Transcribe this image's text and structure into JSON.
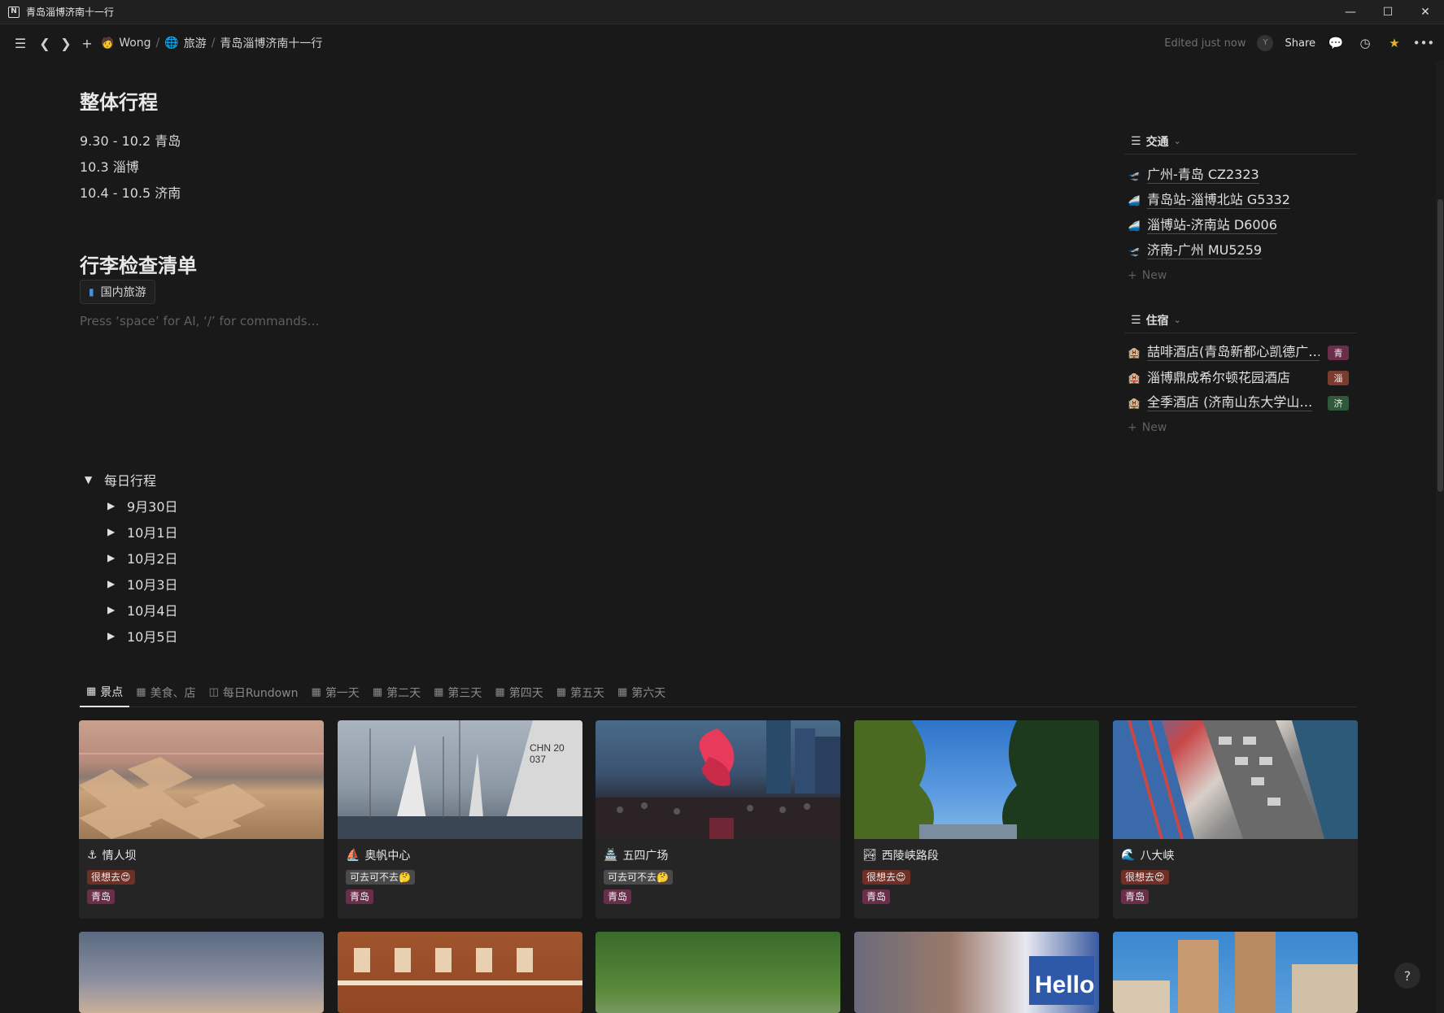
{
  "window": {
    "title": "青岛淄博济南十一行"
  },
  "breadcrumb": {
    "user": "Wong",
    "section": "旅游",
    "page": "青岛淄博济南十一行"
  },
  "topbar": {
    "edited": "Edited just now",
    "avatar_initial": "Y",
    "share": "Share"
  },
  "itinerary": {
    "title": "整体行程",
    "lines": [
      "9.30 - 10.2 青岛",
      "10.3 淄博",
      "10.4 - 10.5 济南"
    ]
  },
  "checklist": {
    "title": "行李检查清单",
    "chip": "国内旅游",
    "placeholder": "Press ‘space’ for AI, ‘/’ for commands…"
  },
  "daily": {
    "title": "每日行程",
    "days": [
      "9月30日",
      "10月1日",
      "10月2日",
      "10月3日",
      "10月4日",
      "10月5日"
    ]
  },
  "transport": {
    "title": "交通",
    "items": [
      {
        "label": "广州-青岛 CZ2323",
        "icon": "plane-icon"
      },
      {
        "label": "青岛站-淄博北站 G5332",
        "icon": "train-icon"
      },
      {
        "label": "淄博站-济南站 D6006",
        "icon": "train-icon"
      },
      {
        "label": "济南-广州 MU5259",
        "icon": "plane-icon"
      }
    ],
    "new": "New"
  },
  "lodging": {
    "title": "住宿",
    "items": [
      {
        "label": "喆啡酒店(青岛新都心凯德广…",
        "tag": "青",
        "color": "#6b2e4a"
      },
      {
        "label": "淄博鼎成希尔顿花园酒店",
        "tag": "淄",
        "color": "#7a3c2e"
      },
      {
        "label": "全季酒店 (济南山东大学山…",
        "tag": "济",
        "color": "#2f5a3a"
      }
    ],
    "new": "New"
  },
  "tabs": [
    "景点",
    "美食、店",
    "每日Rundown",
    "第一天",
    "第二天",
    "第三天",
    "第四天",
    "第五天",
    "第六天"
  ],
  "cards": [
    {
      "icon": "⚓",
      "title": "情人坝",
      "status": "很想去😍",
      "status_color": "#6e2f26",
      "city": "青岛",
      "city_color": "#6b2e4a"
    },
    {
      "icon": "⛵",
      "title": "奥帆中心",
      "status": "可去可不去🤔",
      "status_color": "#4a4a4a",
      "city": "青岛",
      "city_color": "#6b2e4a"
    },
    {
      "icon": "🏯",
      "title": "五四广场",
      "status": "可去可不去🤔",
      "status_color": "#4a4a4a",
      "city": "青岛",
      "city_color": "#6b2e4a"
    },
    {
      "icon": "🏞",
      "title": "西陵峡路段",
      "status": "很想去😍",
      "status_color": "#6e2f26",
      "city": "青岛",
      "city_color": "#6b2e4a"
    },
    {
      "icon": "🌊",
      "title": "八大峡",
      "status": "很想去😍",
      "status_color": "#6e2f26",
      "city": "青岛",
      "city_color": "#6b2e4a"
    }
  ],
  "help": "?"
}
